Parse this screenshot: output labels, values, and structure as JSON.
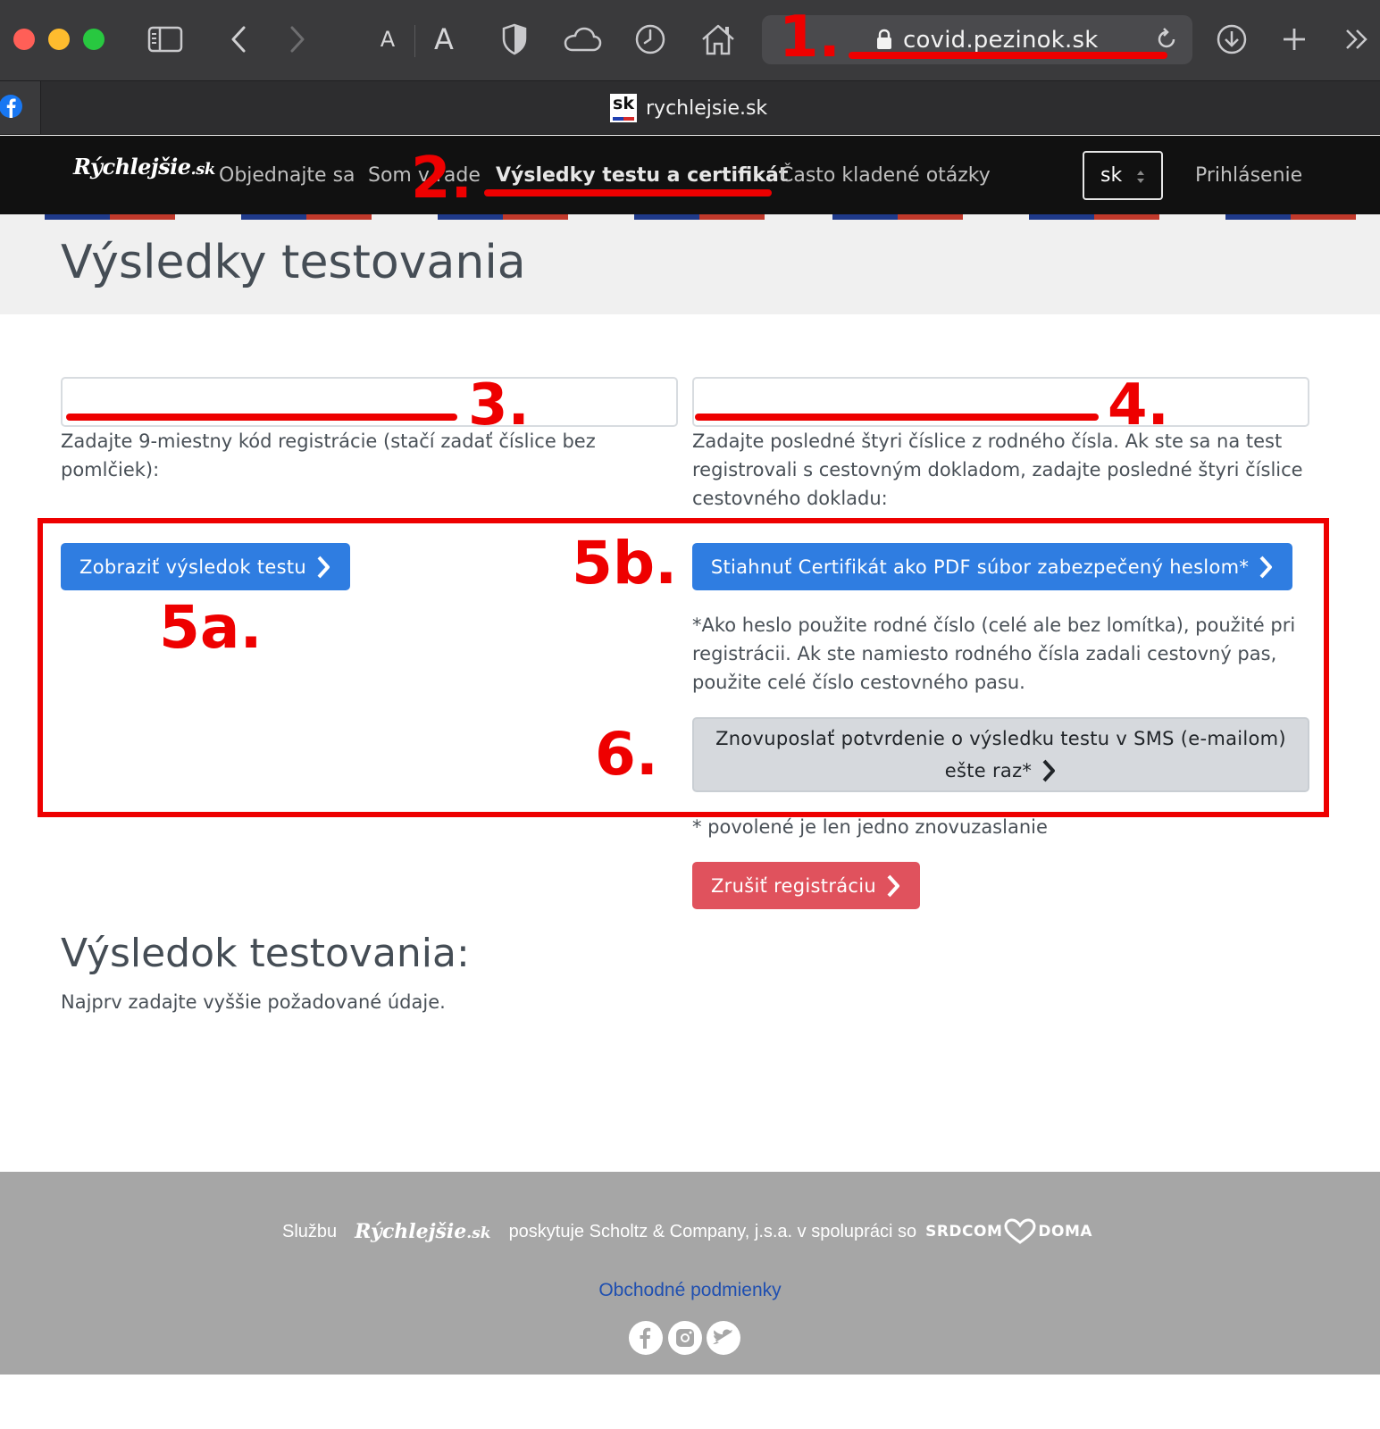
{
  "browser": {
    "url": "covid.pezinok.sk",
    "tab_title": "rychlejsie.sk",
    "tab_favicon_text": "sk",
    "reader_small_label": "A",
    "reader_big_label": "A",
    "icons": [
      "sidebar-icon",
      "back-icon",
      "forward-icon",
      "shield-icon",
      "cloud-icon",
      "history-icon",
      "home-icon",
      "lock-icon",
      "reload-icon",
      "download-icon",
      "new-tab-icon",
      "more-icon",
      "facebook-icon"
    ]
  },
  "nav": {
    "brand_main": "Rýchlejšie",
    "brand_suffix": ".sk",
    "items": [
      {
        "label": "Objednajte sa"
      },
      {
        "label": "Som v rade"
      },
      {
        "label": "Výsledky testu a certifikát"
      },
      {
        "label": "Často kladené otázky"
      }
    ],
    "lang_value": "sk",
    "login_label": "Prihlásenie"
  },
  "page": {
    "title": "Výsledky testovania"
  },
  "form": {
    "code_input_value": "",
    "code_help": "Zadajte 9-miestny kód registrácie (stačí zadať číslice bez pomlčiek):",
    "rc_input_value": "",
    "rc_help": "Zadajte posledné štyri číslice z rodného čísla. Ak ste sa na test registrovali s cestovným dokladom, zadajte posledné štyri číslice cestovného dokladu:",
    "show_result_label": "Zobraziť výsledok testu",
    "download_cert_label": "Stiahnuť Certifikát ako PDF súbor zabezpečený heslom*",
    "password_note": "*Ako heslo použite rodné číslo (celé ale bez lomítka), použité pri registrácii. Ak ste namiesto rodného čísla zadali cestovný pas, použite celé číslo cestovného pasu.",
    "resend_label_line1": "Znovuposlať potvrdenie o výsledku testu v SMS (e-mailom)",
    "resend_label_line2": "ešte raz*",
    "resend_note": "* povolené je len jedno znovuzaslanie",
    "cancel_label": "Zrušiť registráciu"
  },
  "result": {
    "title": "Výsledok testovania:",
    "text": "Najprv zadajte vyššie požadované údaje."
  },
  "footer": {
    "prefix": "Službu",
    "brand_main": "Rýchlejšie",
    "brand_suffix": ".sk",
    "middle": "poskytuje Scholtz & Company, j.s.a. v spolupráci so",
    "partner_left": "SRDCOM",
    "partner_right": "DOMA",
    "terms_link": "Obchodné podmienky",
    "social": [
      "facebook-icon",
      "instagram-icon",
      "twitter-icon"
    ]
  },
  "annotations": {
    "labels": [
      "1.",
      "2.",
      "3.",
      "4.",
      "5a.",
      "5b.",
      "6."
    ],
    "color": "#ee0000"
  },
  "colors": {
    "primary_button": "#2f7de1",
    "danger_button": "#e0525d",
    "secondary_button": "#d6d9dd",
    "nav_background": "#111111",
    "footer_background": "#a6a6a6"
  }
}
